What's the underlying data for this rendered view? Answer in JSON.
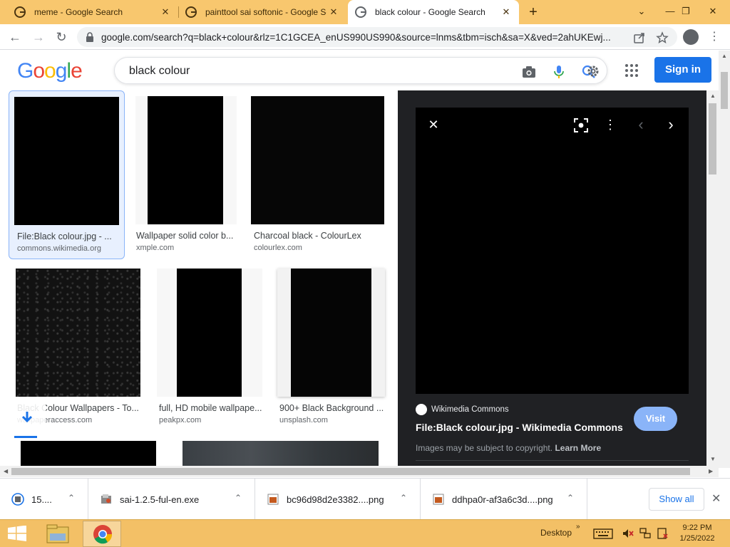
{
  "tabs": [
    {
      "title": "meme - Google Search",
      "active": false
    },
    {
      "title": "painttool sai softonic - Google Se",
      "active": false
    },
    {
      "title": "black colour - Google Search",
      "active": true
    }
  ],
  "new_tab_label": "+",
  "window_controls": {
    "chevron": "⌄",
    "restore": "❐",
    "close": "✕"
  },
  "toolbar": {
    "back_label": "←",
    "forward_label": "→",
    "reload_label": "↻",
    "url": "google.com/search?q=black+colour&rlz=1C1GCEA_enUS990US990&source=lnms&tbm=isch&sa=X&ved=2ahUKEwj...",
    "menu_label": "⋮"
  },
  "google": {
    "logo_letters": [
      "G",
      "o",
      "o",
      "g",
      "l",
      "e"
    ],
    "logo_colors": [
      "#4285f4",
      "#ea4335",
      "#fbbc05",
      "#4285f4",
      "#34a853",
      "#ea4335"
    ],
    "search_query": "black colour",
    "sign_in_label": "Sign in"
  },
  "results": [
    {
      "title": "File:Black colour.jpg - ...",
      "source": "commons.wikimedia.org",
      "selected": true
    },
    {
      "title": "Wallpaper solid color b...",
      "source": "xmple.com",
      "selected": false
    },
    {
      "title": "Charcoal black - ColourLex",
      "source": "colourlex.com",
      "selected": false
    },
    {
      "title": "Black Colour Wallpapers - To...",
      "source": "wallpaperaccess.com",
      "selected": false
    },
    {
      "title": "full, HD mobile wallpape...",
      "source": "peakpx.com",
      "selected": false
    },
    {
      "title": "900+ Black Background ...",
      "source": "unsplash.com",
      "selected": false
    }
  ],
  "preview": {
    "close_label": "✕",
    "more_label": "⋮",
    "prev_label": "‹",
    "next_label": "›",
    "site_name": "Wikimedia Commons",
    "title": "File:Black colour.jpg - Wikimedia Commons",
    "visit_label": "Visit",
    "copyright_text": "Images may be subject to copyright.",
    "learn_more_label": "Learn More"
  },
  "downloads": {
    "items": [
      {
        "name": "15....",
        "icon": "image-file-icon"
      },
      {
        "name": "sai-1.2.5-ful-en.exe",
        "icon": "installer-icon"
      },
      {
        "name": "bc96d98d2e3382....png",
        "icon": "png-file-icon"
      },
      {
        "name": "ddhpa0r-af3a6c3d....png",
        "icon": "png-file-icon"
      }
    ],
    "chevron_label": "⌃",
    "show_all_label": "Show all",
    "close_label": "✕"
  },
  "taskbar": {
    "desktop_label": "Desktop",
    "time": "9:22 PM",
    "date": "1/25/2022"
  }
}
